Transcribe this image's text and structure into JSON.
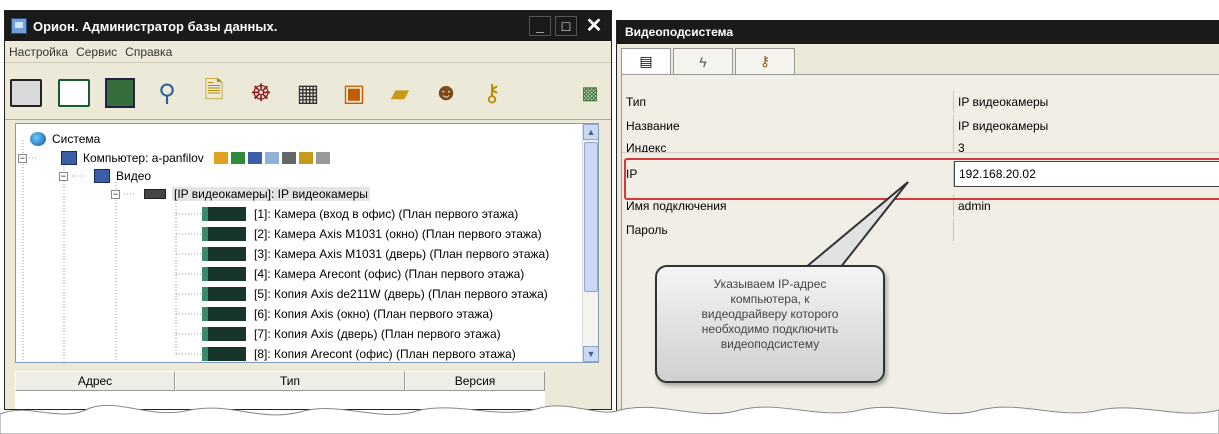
{
  "left_window": {
    "title": "Орион. Администратор базы данных.",
    "buttons": {
      "minimize": "_",
      "maximize": "□",
      "close": "✕"
    },
    "menu": [
      "Настройка",
      "Сервис",
      "Справка"
    ],
    "toolbar_icons": [
      "database-icon",
      "grid-icon",
      "computer-icon",
      "antenna-icon",
      "document-icon",
      "wheel-icon",
      "schedule-icon",
      "report-icon",
      "folder-icon",
      "users-icon",
      "key-icon",
      "exit-icon"
    ],
    "tree": {
      "root": "Система",
      "computer": "Компьютер: a-panfilov",
      "video": "Видео",
      "ip_cams": "[IP видеокамеры]: IP видеокамеры",
      "cameras": [
        "[1]: Камера (вход в офис) (План первого этажа)",
        "[2]: Камера Axis M1031 (окно) (План первого этажа)",
        "[3]: Камера Axis M1031 (дверь) (План первого этажа)",
        "[4]: Камера Arecont (офис) (План первого этажа)",
        "[5]: Копия Axis de211W (дверь) (План первого этажа)",
        "[6]: Копия Axis (окно) (План первого этажа)",
        "[7]: Копия Axis (дверь) (План первого этажа)",
        "[8]: Копия Arecont (офис) (План первого этажа)"
      ]
    },
    "table_headers": [
      "Адрес",
      "Тип",
      "Версия"
    ]
  },
  "right_window": {
    "title": "Видеоподсистема",
    "tabs": [
      "grid-icon",
      "lightning-icon",
      "users-key-icon"
    ],
    "properties": [
      {
        "key": "Тип",
        "value": "IP видеокамеры"
      },
      {
        "key": "Название",
        "value": "IP видеокамеры"
      },
      {
        "key": "Индекс",
        "value": "3"
      },
      {
        "key": "IP",
        "value": "192.168.20.02"
      },
      {
        "key": "Имя подключения",
        "value": "admin"
      },
      {
        "key": "Пароль",
        "value": ""
      }
    ]
  },
  "callout": {
    "lines": [
      "Указываем IP-адрес",
      "компьютера, к",
      "видеодрайверу которого",
      "необходимо подключить",
      "видеоподсистему"
    ]
  },
  "colors": {
    "highlight": "#d23b3b",
    "titlebar": "#1a1a1a"
  }
}
